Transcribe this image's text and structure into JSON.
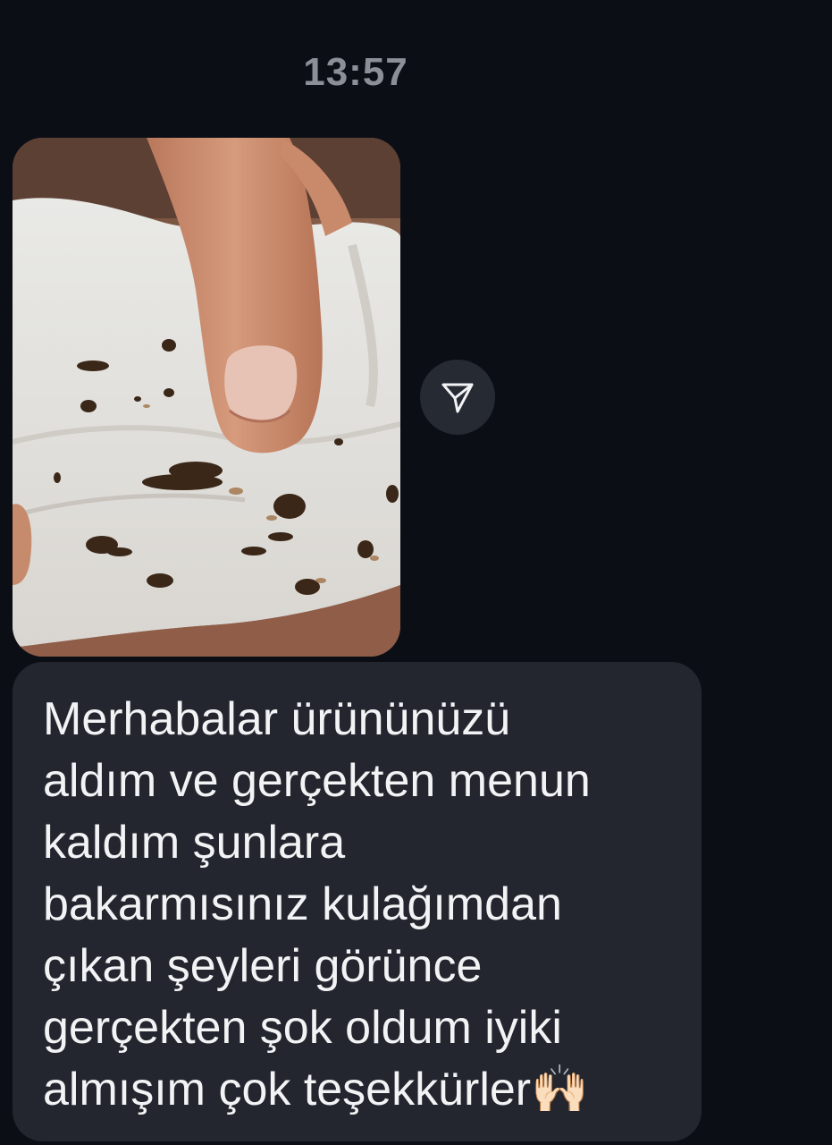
{
  "chat": {
    "timestamp": "13:57",
    "attachment": {
      "type": "photo",
      "description_icon": "photo-attachment"
    },
    "share_icon": "send-icon",
    "message": {
      "text": "Merhabalar ürününüzü\naldım ve gerçekten menun\nkaldım şunlara\nbakarmısınız kulağımdan\nçıkan şeyleri görünce\ngerçekten şok oldum iyiki\nalmışım çok teşekkürler🙌🏻"
    }
  },
  "colors": {
    "background": "#0b0e15",
    "bubble": "#23262e",
    "timestamp": "#8b9098",
    "message_text": "#f2f3f5",
    "share_button": "#262a32"
  }
}
